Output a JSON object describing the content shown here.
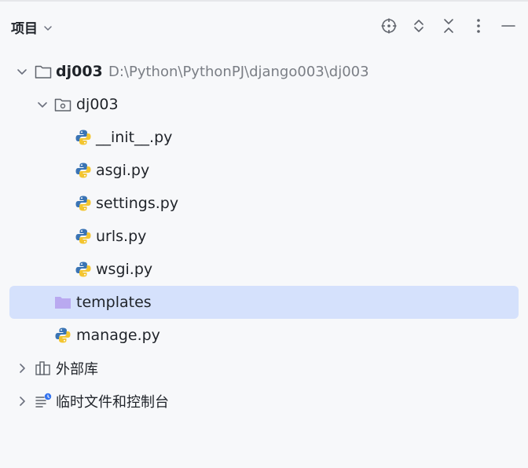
{
  "header": {
    "title": "项目",
    "toolbar": [
      "crosshair-icon",
      "expand-icon",
      "collapse-icon",
      "more-vertical-icon",
      "minimize-icon"
    ]
  },
  "tree": {
    "root": {
      "label": "dj003",
      "path": "D:\\Python\\PythonPJ\\django003\\dj003",
      "icon": "folder-icon"
    },
    "package": {
      "label": "dj003",
      "icon": "package-folder-icon"
    },
    "files": [
      {
        "label": "__init__.py",
        "icon": "python-file-icon"
      },
      {
        "label": "asgi.py",
        "icon": "python-file-icon"
      },
      {
        "label": "settings.py",
        "icon": "python-file-icon"
      },
      {
        "label": "urls.py",
        "icon": "python-file-icon"
      },
      {
        "label": "wsgi.py",
        "icon": "python-file-icon"
      }
    ],
    "templates": {
      "label": "templates",
      "icon": "templates-folder-icon"
    },
    "manage": {
      "label": "manage.py",
      "icon": "python-file-icon"
    },
    "external": {
      "label": "外部库",
      "icon": "library-icon"
    },
    "scratches": {
      "label": "临时文件和控制台",
      "icon": "scratches-icon"
    }
  },
  "colors": {
    "background": "#f7f8fa",
    "selection": "#d5e1fc",
    "python_blue": "#3a74b4",
    "python_yellow": "#f3c530",
    "templates_folder": "#b9a9f0"
  }
}
